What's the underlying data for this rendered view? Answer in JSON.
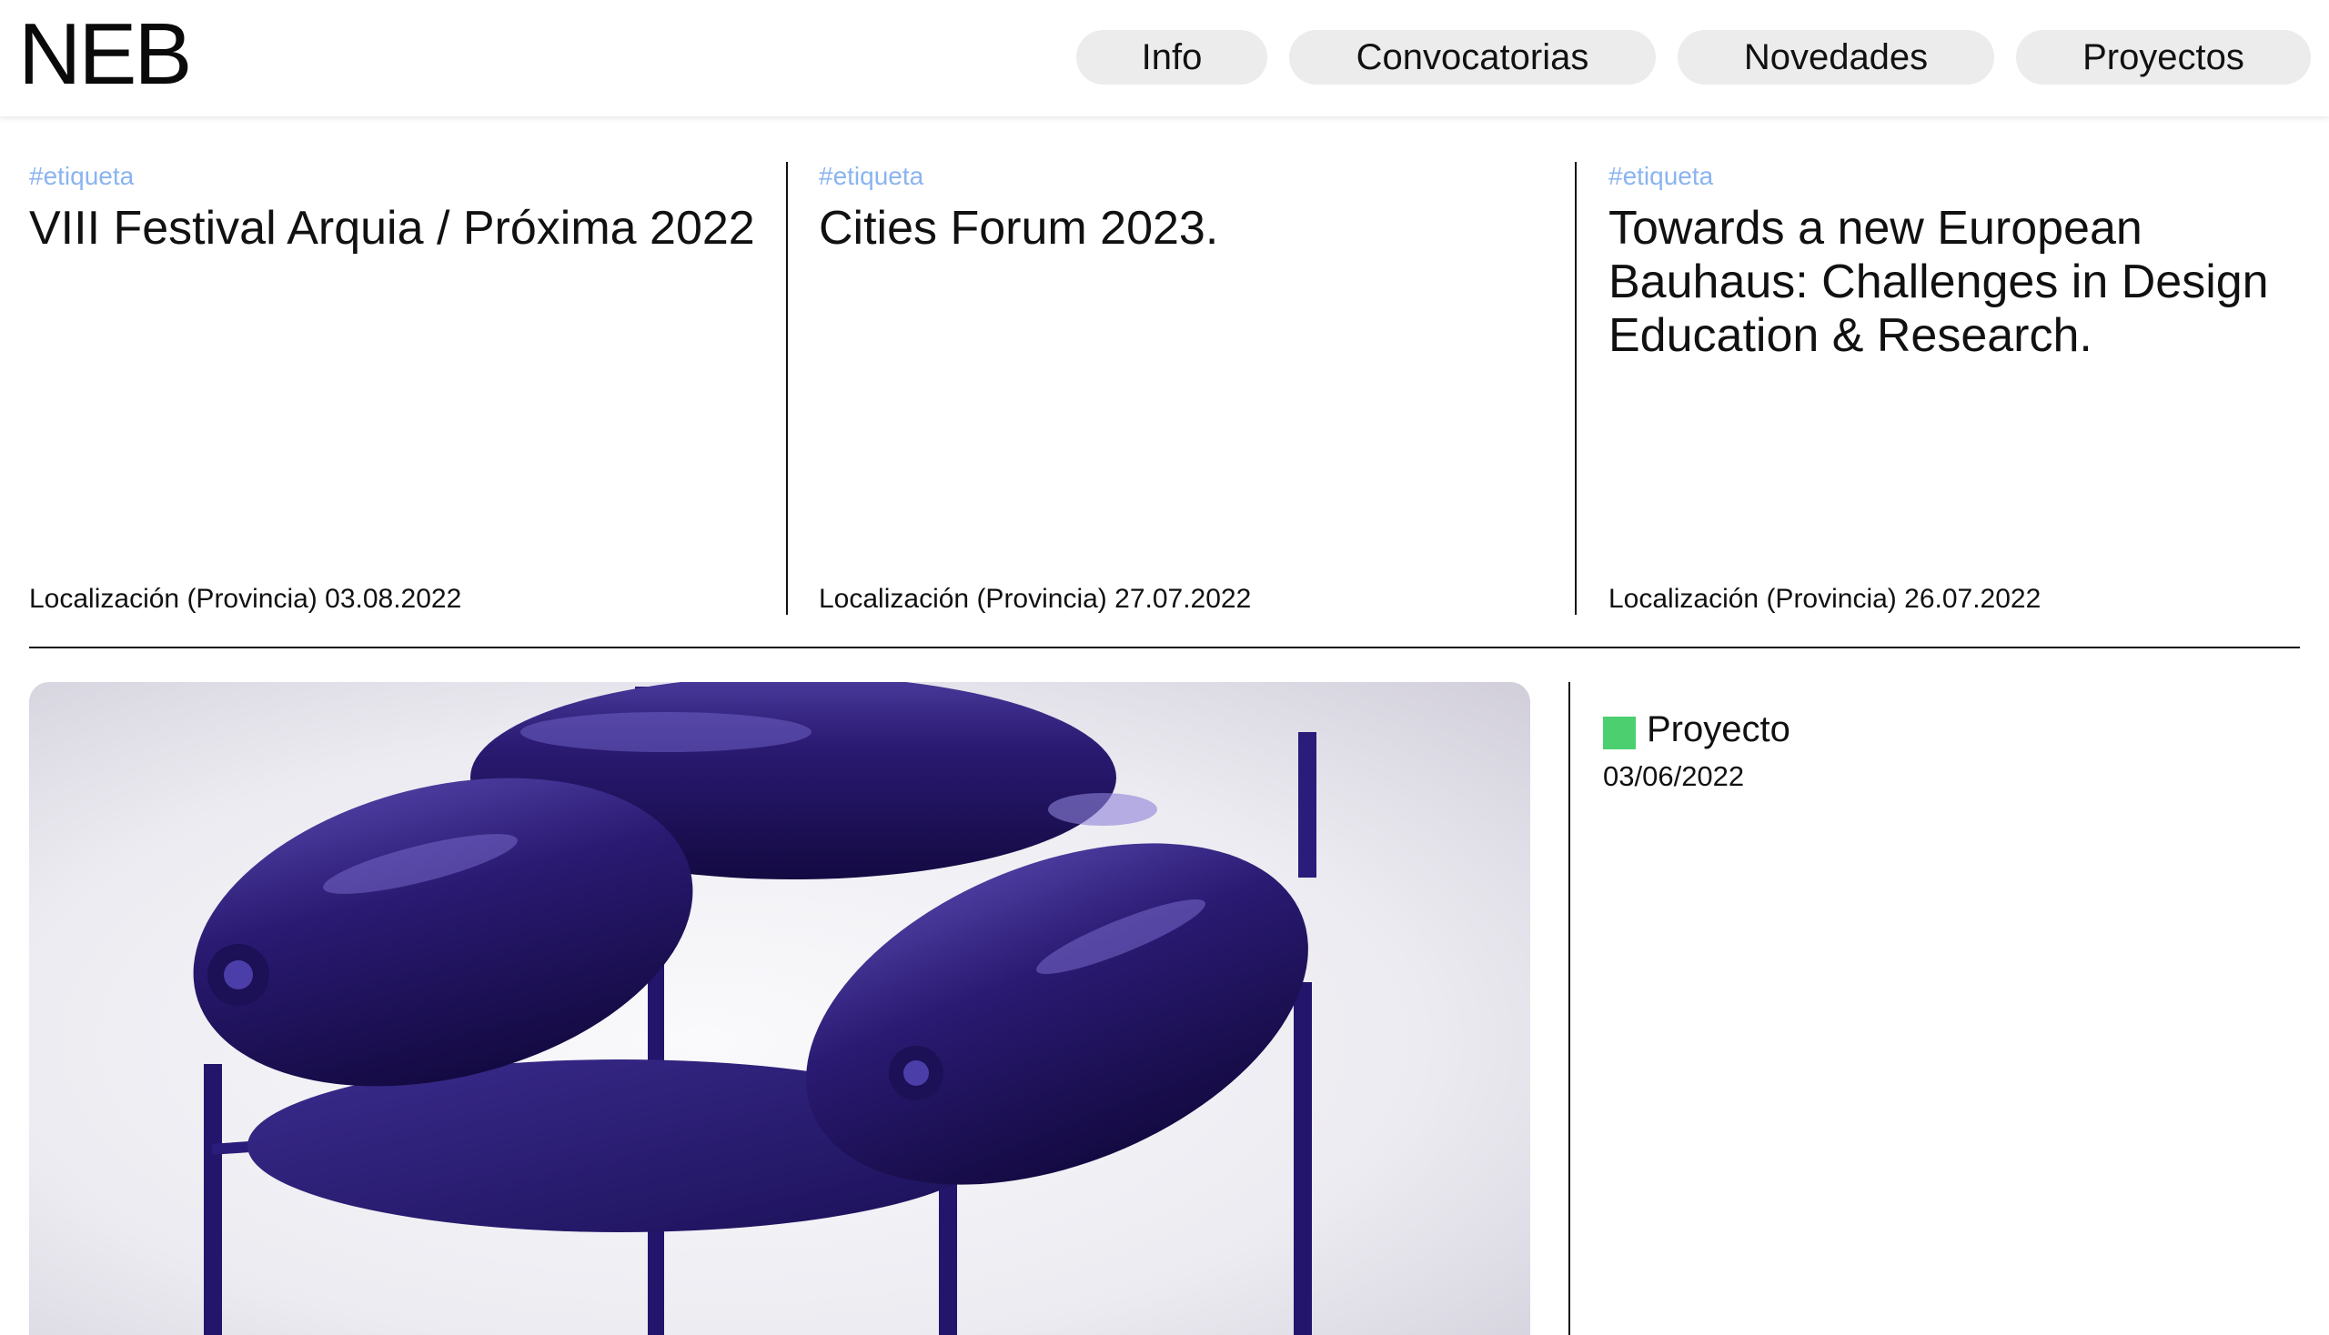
{
  "header": {
    "logo": "NEB",
    "nav": [
      "Info",
      "Convocatorias",
      "Novedades",
      "Proyectos"
    ]
  },
  "cards": [
    {
      "tag": "#etiqueta",
      "title": "VIII Festival Arquia / Próxima 2022",
      "meta": "Localización (Provincia) 03.08.2022"
    },
    {
      "tag": "#etiqueta",
      "title": "Cities Forum 2023.",
      "meta": "Localización (Provincia) 27.07.2022"
    },
    {
      "tag": "#etiqueta",
      "title": "Towards a new European Bauhaus: Challenges in Design Education & Research.",
      "meta": "Localización (Provincia) 26.07.2022"
    }
  ],
  "feature": {
    "badge_color": "#4ccf6f",
    "label": "Proyecto",
    "date": "03/06/2022"
  },
  "colors": {
    "tag": "#8ab4f0",
    "nav_pill": "#ececec",
    "chair_blue": "#23125f"
  }
}
